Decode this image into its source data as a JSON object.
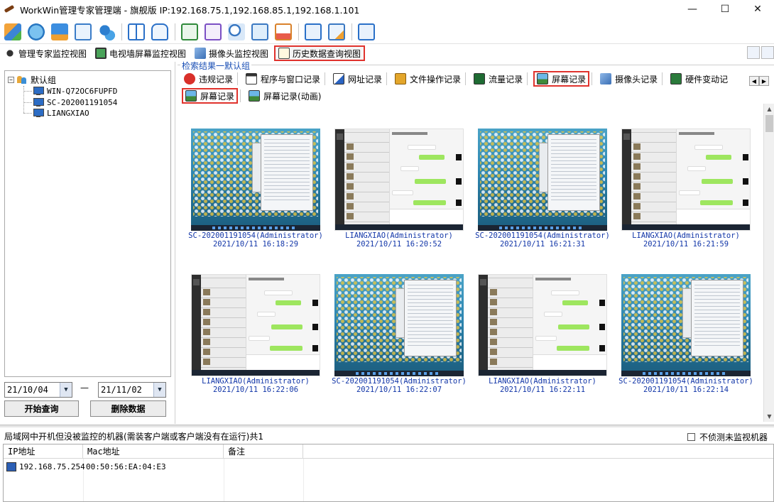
{
  "window": {
    "title": "WorkWin管理专家管理端 - 旗舰版 IP:192.168.75.1,192.168.85.1,192.168.1.101",
    "minimize": "—",
    "maximize": "☐",
    "close": "✕"
  },
  "view_tabs": [
    {
      "label": "管理专家监控视图"
    },
    {
      "label": "电视墙屏幕监控视图"
    },
    {
      "label": "摄像头监控视图"
    },
    {
      "label": "历史数据查询视图"
    }
  ],
  "tree": {
    "root": "默认组",
    "expander": "−",
    "children": [
      "WIN-Q72OC6FUPFD",
      "SC-202001191054",
      "LIANGXIAO"
    ]
  },
  "query": {
    "date_from": "21/10/04",
    "date_to": "21/11/02",
    "dash": "—",
    "start_button": "开始查询",
    "delete_button": "删除数据"
  },
  "results": {
    "label": "检索结果一默认组"
  },
  "categories_row1": [
    {
      "label": "违规记录"
    },
    {
      "label": "程序与窗口记录"
    },
    {
      "label": "网址记录"
    },
    {
      "label": "文件操作记录"
    },
    {
      "label": "流量记录"
    },
    {
      "label": "屏幕记录"
    },
    {
      "label": "摄像头记录"
    },
    {
      "label": "硬件变动记"
    }
  ],
  "categories_row2": [
    {
      "label": "屏幕记录"
    },
    {
      "label": "屏幕记录(动画)"
    }
  ],
  "tab_arrows": {
    "left": "◀",
    "right": "▶"
  },
  "screenshots": [
    {
      "kind": "desktop",
      "machine": "SC-202001191054(Administrator)",
      "time": "2021/10/11 16:18:29"
    },
    {
      "kind": "chat",
      "machine": "LIANGXIAO(Administrator)",
      "time": "2021/10/11 16:20:52"
    },
    {
      "kind": "desktop",
      "machine": "SC-202001191054(Administrator)",
      "time": "2021/10/11 16:21:31"
    },
    {
      "kind": "chat",
      "machine": "LIANGXIAO(Administrator)",
      "time": "2021/10/11 16:21:59"
    },
    {
      "kind": "chat",
      "machine": "LIANGXIAO(Administrator)",
      "time": "2021/10/11 16:22:06"
    },
    {
      "kind": "desktop",
      "machine": "SC-202001191054(Administrator)",
      "time": "2021/10/11 16:22:07"
    },
    {
      "kind": "chat",
      "machine": "LIANGXIAO(Administrator)",
      "time": "2021/10/11 16:22:11"
    },
    {
      "kind": "desktop",
      "machine": "SC-202001191054(Administrator)",
      "time": "2021/10/11 16:22:14"
    }
  ],
  "scroll": {
    "up": "▲",
    "down": "▼"
  },
  "bottom": {
    "label": "局域网中开机但没被监控的机器(需装客户端或客户端没有在运行)共1",
    "checkbox_label": "不侦测未监视机器",
    "columns": [
      "IP地址",
      "Mac地址",
      "备注"
    ],
    "rows": [
      {
        "ip": "192.168.75.254",
        "mac": "00:50:56:EA:04:E3",
        "note": ""
      }
    ]
  },
  "colors": {
    "highlight_border": "#e0332d",
    "caption_blue": "#1236a8",
    "result_label_blue": "#1a4fb5"
  }
}
